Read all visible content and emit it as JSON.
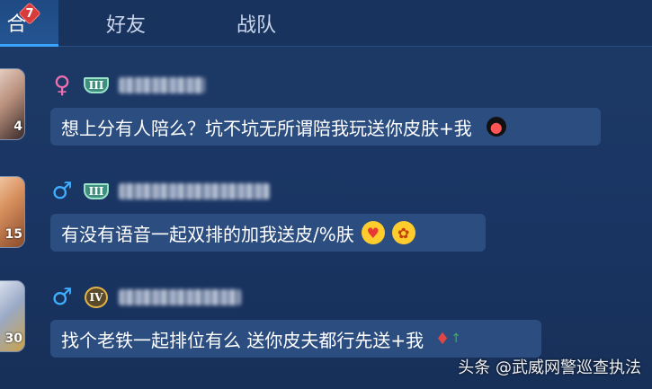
{
  "tabs": [
    {
      "label": "合",
      "badge": "7",
      "active": true
    },
    {
      "label": "好友",
      "active": false
    },
    {
      "label": "战队",
      "active": false
    }
  ],
  "messages": [
    {
      "avatar_level": "4",
      "gender": "♀",
      "rank_label": "III",
      "text": "想上分有人陪么？坑不坑无所谓陪我玩送你皮肤+我",
      "emojis": [
        "bomb-emoji"
      ]
    },
    {
      "avatar_level": "15",
      "gender": "♂",
      "rank_label": "III",
      "text": "有没有语音一起双排的加我送皮/%肤",
      "emojis": [
        "heart-eyes-emoji",
        "kiss-emoji"
      ]
    },
    {
      "avatar_level": "30",
      "gender": "♂",
      "rank_label": "IV",
      "text": "找个老铁一起排位有么 送你皮夫都行先送+我",
      "emojis": [
        "rose-emoji"
      ]
    }
  ],
  "watermark": "头条 @武威网警巡查执法",
  "colors": {
    "background": "#1a3563",
    "bubble": "#2b4d80",
    "badge": "#d93a3a",
    "female": "#f06fb0",
    "male": "#3fb0ff",
    "tab_indicator": "#39a3ff"
  }
}
